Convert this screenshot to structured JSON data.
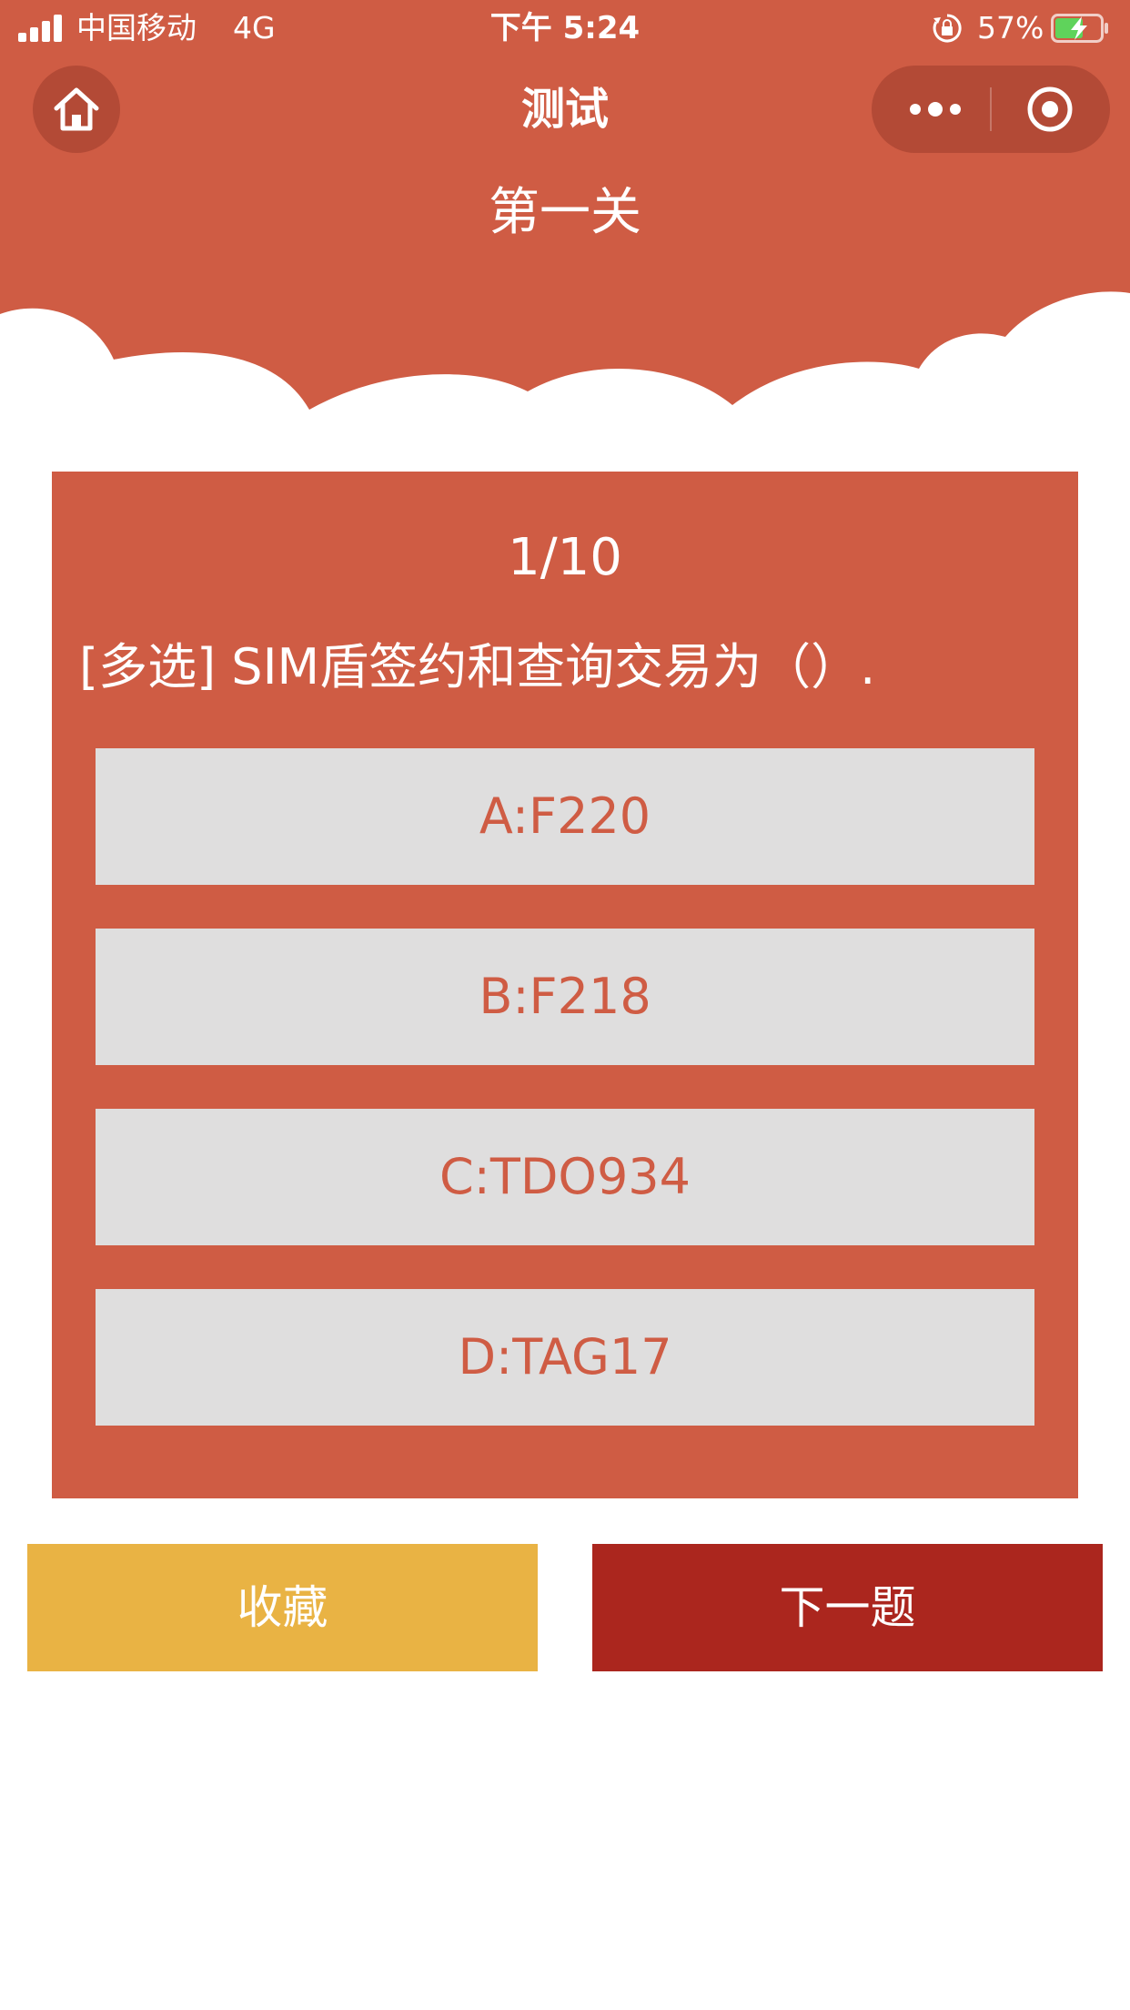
{
  "status_bar": {
    "carrier": "中国移动",
    "network": "4G",
    "time": "下午 5:24",
    "battery_percent": "57%"
  },
  "nav": {
    "title": "测试",
    "home_icon": "home-icon",
    "more_icon": "more-dots-icon",
    "close_icon": "target-circle-icon"
  },
  "level": {
    "title": "第一关"
  },
  "question": {
    "progress": "1/10",
    "text": "[多选] SIM盾签约和查询交易为（）.",
    "options": [
      {
        "label": "A:F220"
      },
      {
        "label": "B:F218"
      },
      {
        "label": "C:TDO934"
      },
      {
        "label": "D:TAG17"
      }
    ]
  },
  "actions": {
    "favorite_label": "收藏",
    "next_label": "下一题"
  },
  "colors": {
    "primary": "#cf5c44",
    "option_bg": "#dfdede",
    "favorite": "#e9b344",
    "next": "#ab261e"
  }
}
